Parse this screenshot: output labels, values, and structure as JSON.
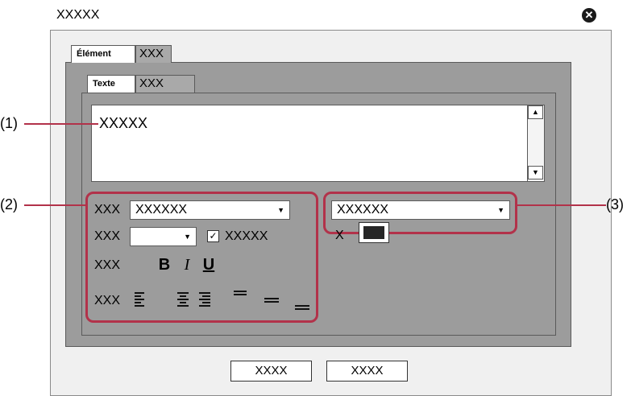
{
  "dialog": {
    "title": "XXXXX"
  },
  "tabs": {
    "main": [
      "Élément",
      "XXX"
    ],
    "sub": [
      "Texte",
      "XXX"
    ]
  },
  "text_area": {
    "value": "XXXXX"
  },
  "format_group": {
    "font_label": "XXX",
    "font_value": "XXXXXX",
    "size_label": "XXX",
    "size_value": "",
    "checkbox_label": "XXXXX",
    "style_label": "XXX",
    "bold": "B",
    "italic": "I",
    "underline": "U",
    "align_label": "XXX"
  },
  "color_group": {
    "dropdown_value": "XXXXXX",
    "color_label": "X",
    "swatch_color": "#262626"
  },
  "buttons": {
    "ok": "XXXX",
    "cancel": "XXXX"
  },
  "callouts": {
    "one": "(1)",
    "two": "(2)",
    "three": "(3)"
  },
  "colors": {
    "callout": "#b2324a",
    "panel": "#9c9c9c"
  }
}
